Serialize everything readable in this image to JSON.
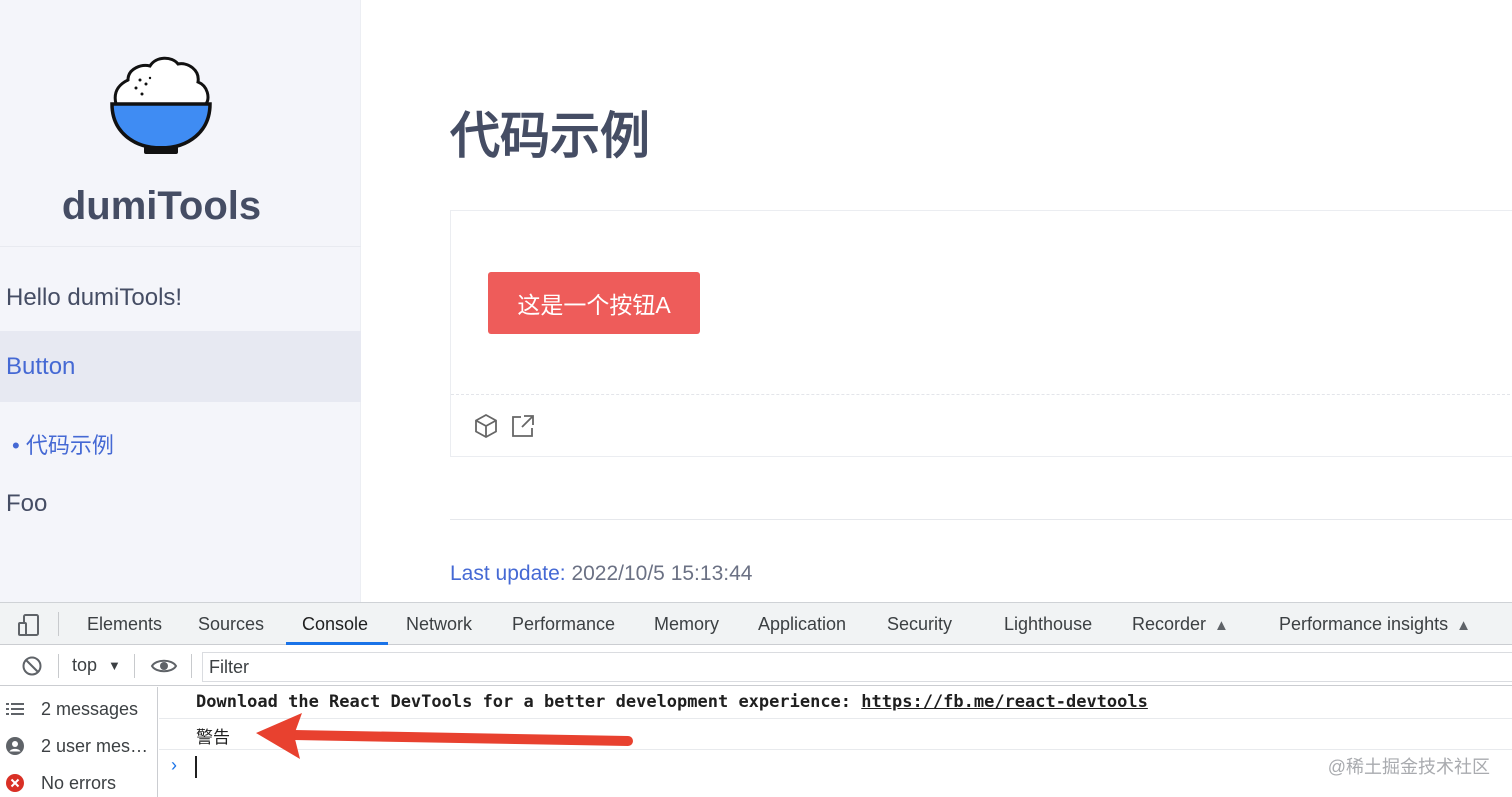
{
  "sidebar": {
    "brand": "dumiTools",
    "items": [
      {
        "label": "Hello dumiTools!"
      },
      {
        "label": "Button"
      },
      {
        "label": "• 代码示例"
      },
      {
        "label": "Foo"
      }
    ]
  },
  "main": {
    "title": "代码示例",
    "demo_button_label": "这是一个按钮A",
    "last_update_label": "Last update:",
    "last_update_value": "2022/10/5 15:13:44"
  },
  "devtools": {
    "tabs": [
      {
        "label": "Elements"
      },
      {
        "label": "Sources"
      },
      {
        "label": "Console",
        "active": true
      },
      {
        "label": "Network"
      },
      {
        "label": "Performance"
      },
      {
        "label": "Memory"
      },
      {
        "label": "Application"
      },
      {
        "label": "Security"
      },
      {
        "label": "Lighthouse"
      },
      {
        "label": "Recorder"
      },
      {
        "label": "Performance insights"
      }
    ],
    "context": "top",
    "filter_placeholder": "Filter",
    "sidebar": [
      {
        "label": "2 messages",
        "icon": "list-icon"
      },
      {
        "label": "2 user mes…",
        "icon": "user-icon"
      },
      {
        "label": "No errors",
        "icon": "error-icon"
      }
    ],
    "messages": {
      "msg1_text": "Download the React DevTools for a better development experience: ",
      "msg1_link": "https://fb.me/react-devtools",
      "msg2_text": "警告"
    },
    "watermark": "@稀土掘金技术社区"
  },
  "colors": {
    "accent_blue": "#4569d4",
    "button_red": "#ee5c5a",
    "devtools_active": "#1a73e8",
    "annotation_arrow": "#e8412f"
  }
}
